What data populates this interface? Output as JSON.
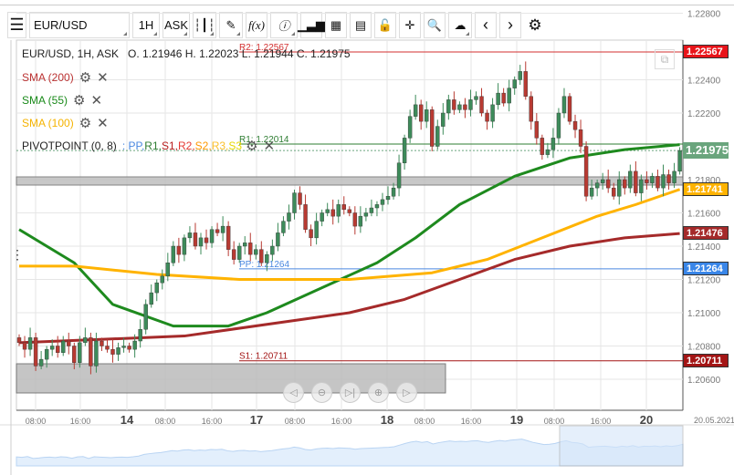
{
  "toolbar": {
    "symbol": "EUR/USD",
    "timeframe": "1H",
    "price_side": "ASK",
    "buttons": [
      "menu-icon",
      "candles-icon",
      "draw-icon",
      "function-icon",
      "info-icon",
      "volume-icon",
      "calendar-icon",
      "report-icon",
      "lock-icon",
      "crosshair-icon",
      "zoom-icon",
      "upload-icon",
      "prev-icon",
      "next-icon",
      "settings-icon"
    ],
    "fx_label": "f(x)"
  },
  "legend": {
    "ohlc": "EUR/USD, 1H, ASK   O. 1.21946 H. 1.22023 L. 1.21944 C. 1.21975",
    "sma200": "SMA (200)",
    "sma55": "SMA (55)",
    "sma100": "SMA (100)",
    "pivot": "PIVOTPOINT (0, 8)",
    "pivot_items": [
      ": PP,",
      " R1,",
      " S1,",
      " R2,",
      " S2,",
      " R3,",
      " S3"
    ]
  },
  "colors": {
    "up": "#3d8b5a",
    "down": "#b83a32",
    "sma200": "#a52a2a",
    "sma55": "#1e8a1e",
    "sma100": "#ffb300",
    "pp": "#4a88e0",
    "r1": "#2e7d32",
    "s1": "#b71c1c",
    "r2": "#e53935",
    "s2": "#ff9800",
    "r3": "#fbc02d",
    "s3": "#e6d800"
  },
  "chart_data": {
    "type": "candlestick",
    "symbol": "EUR/USD",
    "interval": "1H",
    "ylim": [
      1.205,
      1.2285
    ],
    "y_ticks": [
      "1.22800",
      "1.22400",
      "1.22200",
      "1.21800",
      "1.21600",
      "1.21400",
      "1.21200",
      "1.21000",
      "1.20800",
      "1.20600"
    ],
    "x_ticks": [
      "08:00",
      "16:00",
      "14",
      "08:00",
      "16:00",
      "17",
      "08:00",
      "16:00",
      "18",
      "08:00",
      "16:00",
      "19",
      "08:00",
      "16:00",
      "20"
    ],
    "date_label": "20.05.2021",
    "closes": [
      1.2082,
      1.2078,
      1.2085,
      1.2068,
      1.2072,
      1.2078,
      1.208,
      1.2076,
      1.2083,
      1.208,
      1.207,
      1.2082,
      1.2085,
      1.2068,
      1.2083,
      1.208,
      1.2078,
      1.2075,
      1.2079,
      1.208,
      1.2078,
      1.2083,
      1.209,
      1.2105,
      1.2112,
      1.2118,
      1.2122,
      1.213,
      1.214,
      1.2135,
      1.2145,
      1.2148,
      1.214,
      1.2145,
      1.2142,
      1.215,
      1.2148,
      1.2152,
      1.2138,
      1.2132,
      1.214,
      1.2142,
      1.2135,
      1.2138,
      1.213,
      1.2135,
      1.214,
      1.2148,
      1.2155,
      1.216,
      1.2172,
      1.2165,
      1.215,
      1.2145,
      1.2155,
      1.216,
      1.2162,
      1.2158,
      1.2165,
      1.2162,
      1.216,
      1.2152,
      1.2158,
      1.216,
      1.2163,
      1.2165,
      1.2168,
      1.217,
      1.2175,
      1.219,
      1.2205,
      1.2218,
      1.2225,
      1.2215,
      1.2222,
      1.22,
      1.2212,
      1.222,
      1.2228,
      1.2222,
      1.2225,
      1.2222,
      1.2228,
      1.223,
      1.222,
      1.2215,
      1.2225,
      1.2232,
      1.2226,
      1.2235,
      1.224,
      1.2245,
      1.223,
      1.2215,
      1.2205,
      1.2195,
      1.2198,
      1.2205,
      1.222,
      1.223,
      1.2215,
      1.221,
      1.22,
      1.217,
      1.2175,
      1.2178,
      1.218,
      1.2175,
      1.217,
      1.218,
      1.2175,
      1.2185,
      1.2172,
      1.218,
      1.2178,
      1.2182,
      1.2175,
      1.2183,
      1.2178,
      1.2185,
      1.21975
    ],
    "sma": [
      {
        "name": "SMA (200)",
        "color": "#a52a2a",
        "points": [
          [
            0,
            1.2082
          ],
          [
            30,
            1.2086
          ],
          [
            60,
            1.21
          ],
          [
            70,
            1.2108
          ],
          [
            80,
            1.212
          ],
          [
            90,
            1.2132
          ],
          [
            100,
            1.214
          ],
          [
            110,
            1.2145
          ],
          [
            120,
            1.21476
          ]
        ]
      },
      {
        "name": "SMA (55)",
        "color": "#1e8a1e",
        "points": [
          [
            0,
            1.215
          ],
          [
            10,
            1.213
          ],
          [
            17,
            1.2105
          ],
          [
            28,
            1.2092
          ],
          [
            38,
            1.2092
          ],
          [
            45,
            1.21
          ],
          [
            55,
            1.2115
          ],
          [
            65,
            1.213
          ],
          [
            72,
            1.2145
          ],
          [
            80,
            1.2165
          ],
          [
            90,
            1.2182
          ],
          [
            100,
            1.2193
          ],
          [
            110,
            1.2198
          ],
          [
            120,
            1.2201
          ]
        ]
      },
      {
        "name": "SMA (100)",
        "color": "#ffb300",
        "points": [
          [
            0,
            1.2128
          ],
          [
            10,
            1.2128
          ],
          [
            25,
            1.2123
          ],
          [
            40,
            1.212
          ],
          [
            60,
            1.212
          ],
          [
            75,
            1.2124
          ],
          [
            85,
            1.2132
          ],
          [
            95,
            1.2145
          ],
          [
            105,
            1.2158
          ],
          [
            112,
            1.2165
          ],
          [
            120,
            1.21741
          ]
        ]
      }
    ],
    "pivots": [
      {
        "label": "R2: 1.22567",
        "value": 1.22567,
        "color": "#d32f2f"
      },
      {
        "label": "R1: 1.22014",
        "value": 1.22014,
        "color": "#2e7d32"
      },
      {
        "label": "PP: 1.21264",
        "value": 1.21264,
        "color": "#4a88e0"
      },
      {
        "label": "S1: 1.20711",
        "value": 1.20711,
        "color": "#a31515"
      }
    ],
    "price_tags": [
      {
        "text": "1.22567",
        "value": 1.22567,
        "color": "#e8141a"
      },
      {
        "text": "1.21975",
        "value": 1.21975,
        "color": "#6aa57d"
      },
      {
        "text": "1.21741",
        "value": 1.21741,
        "color": "#ffb300"
      },
      {
        "text": "1.21476",
        "value": 1.21476,
        "color": "#a52a2a"
      },
      {
        "text": "1.21264",
        "value": 1.21264,
        "color": "#3a86e8"
      },
      {
        "text": "1.20711",
        "value": 1.20711,
        "color": "#a31515"
      }
    ]
  }
}
